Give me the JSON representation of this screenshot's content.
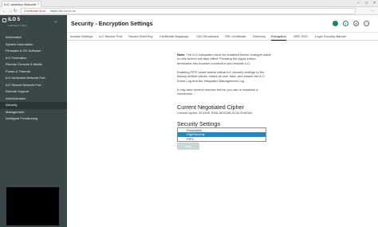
{
  "browser": {
    "tab_title": "iLO: whitebox Bottom6",
    "tab_close": "×",
    "window_controls": [
      "–",
      "□",
      "×"
    ],
    "back": "←",
    "forward": "→",
    "reload": "↻",
    "cert_warning": "Certificate error",
    "url": "https://ilo-xx.xx.xx",
    "menu": "⋯"
  },
  "sidebar": {
    "brand": "iLO 5",
    "subtitle": "1.30 Aug 17 2017",
    "collapse": "⇔",
    "items": [
      "Information",
      "System Information",
      "Firmware & OS Software",
      "iLO Federation",
      "Remote Console & Media",
      "Power & Thermal",
      "iLO Dedicated Network Port",
      "iLO Shared Network Port",
      "Remote Support",
      "Administration",
      "Security",
      "Management",
      "Intelligent Provisioning"
    ],
    "active_index": 10
  },
  "header": {
    "title": "Security - Encryption Settings",
    "health_icon": "health-status-icon",
    "power_icon": "power-icon",
    "user_icon": "user-icon",
    "help_icon": "help-icon",
    "power_glyph": "◐",
    "user_glyph": "●",
    "help_glyph": "?"
  },
  "tabs": [
    "Access Settings",
    "iLO Service Port",
    "Secure Shell Key",
    "Certificate Mappings",
    "CAC/Smartcard",
    "SSL Certificate",
    "Directory",
    "Encryption",
    "HPE SSO",
    "Login Security Banner"
  ],
  "active_tab": 7,
  "content": {
    "note_label": "Note:",
    "note_text": "The iLO subsystem must be restarted before changes made on this screen will take effect. Pressing the Apply button terminates this browser connection and restarts iLO.",
    "fips_text": "Enabling FIPS mode resets critical iLO security settings to the factory default values, clears all user data, and erases the iLO Event Log and the Integrated Management Log.",
    "wait_text": "It may take several minutes before you can re-establish a connection.",
    "cipher_heading": "Current Negotiated Cipher",
    "cipher_label": "Current cipher:",
    "cipher_value": "ECDHE-RSA-AES256-GCM-SHA384",
    "settings_heading": "Security Settings",
    "modes": [
      "Production",
      "HighSecurity",
      "FIPS"
    ],
    "selected_mode": 1,
    "apply": "Apply"
  },
  "colors": {
    "sidebar_bg": "#3a4748",
    "accent": "#0f8a74",
    "selection": "#1e88c9",
    "apply_disabled": "#c6d9d8"
  }
}
